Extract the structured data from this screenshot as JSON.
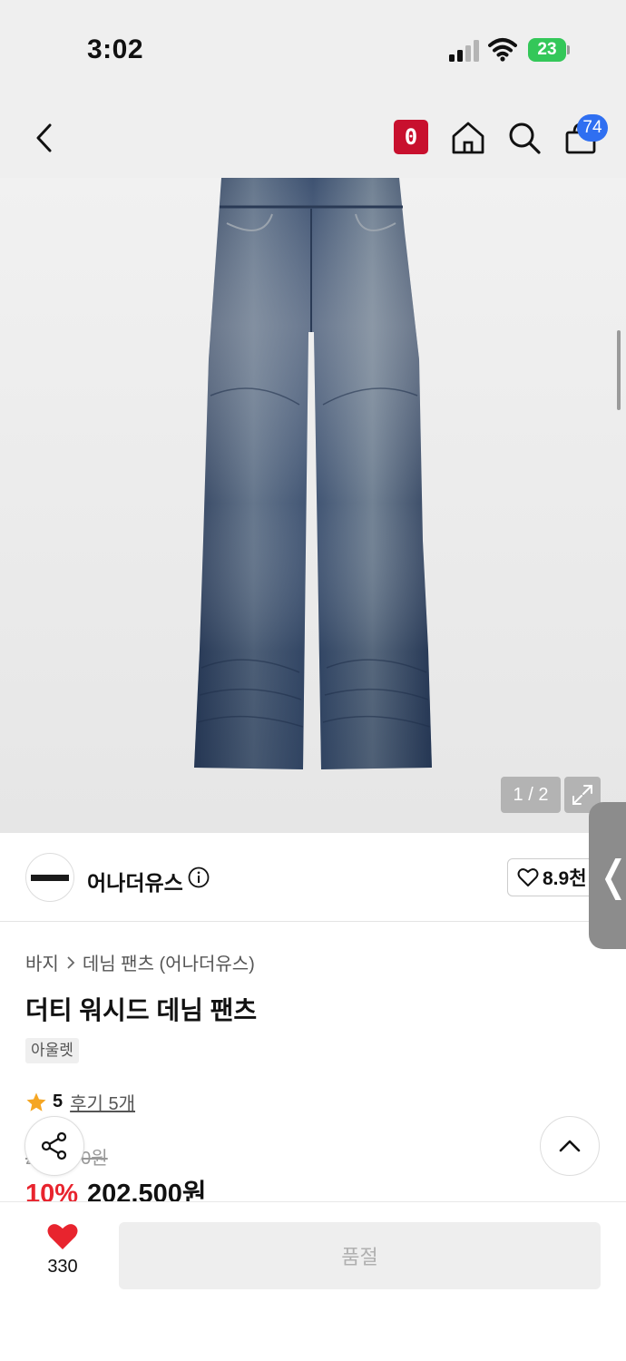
{
  "status_bar": {
    "time": "3:02",
    "battery": "23"
  },
  "nav": {
    "badge_label": "0",
    "cart_count": "74"
  },
  "gallery": {
    "page_indicator": "1 / 2"
  },
  "brand": {
    "name": "어나더유스",
    "likes": "8.9천"
  },
  "product": {
    "breadcrumb": [
      "바지",
      "데님 팬츠 (어나더유스)"
    ],
    "title": "더티 워시드 데님 팬츠",
    "tag": "아울렛",
    "rating": "5",
    "review_link": "후기 5개",
    "original_price": "225,000원",
    "discount": "10%",
    "price": "202,500원"
  },
  "bottom_bar": {
    "wish_count": "330",
    "buy_label": "품절"
  },
  "colors": {
    "accent_red": "#e8242e",
    "badge_red": "#c8102e",
    "cart_blue": "#2f6ff1",
    "star": "#f5a623"
  }
}
